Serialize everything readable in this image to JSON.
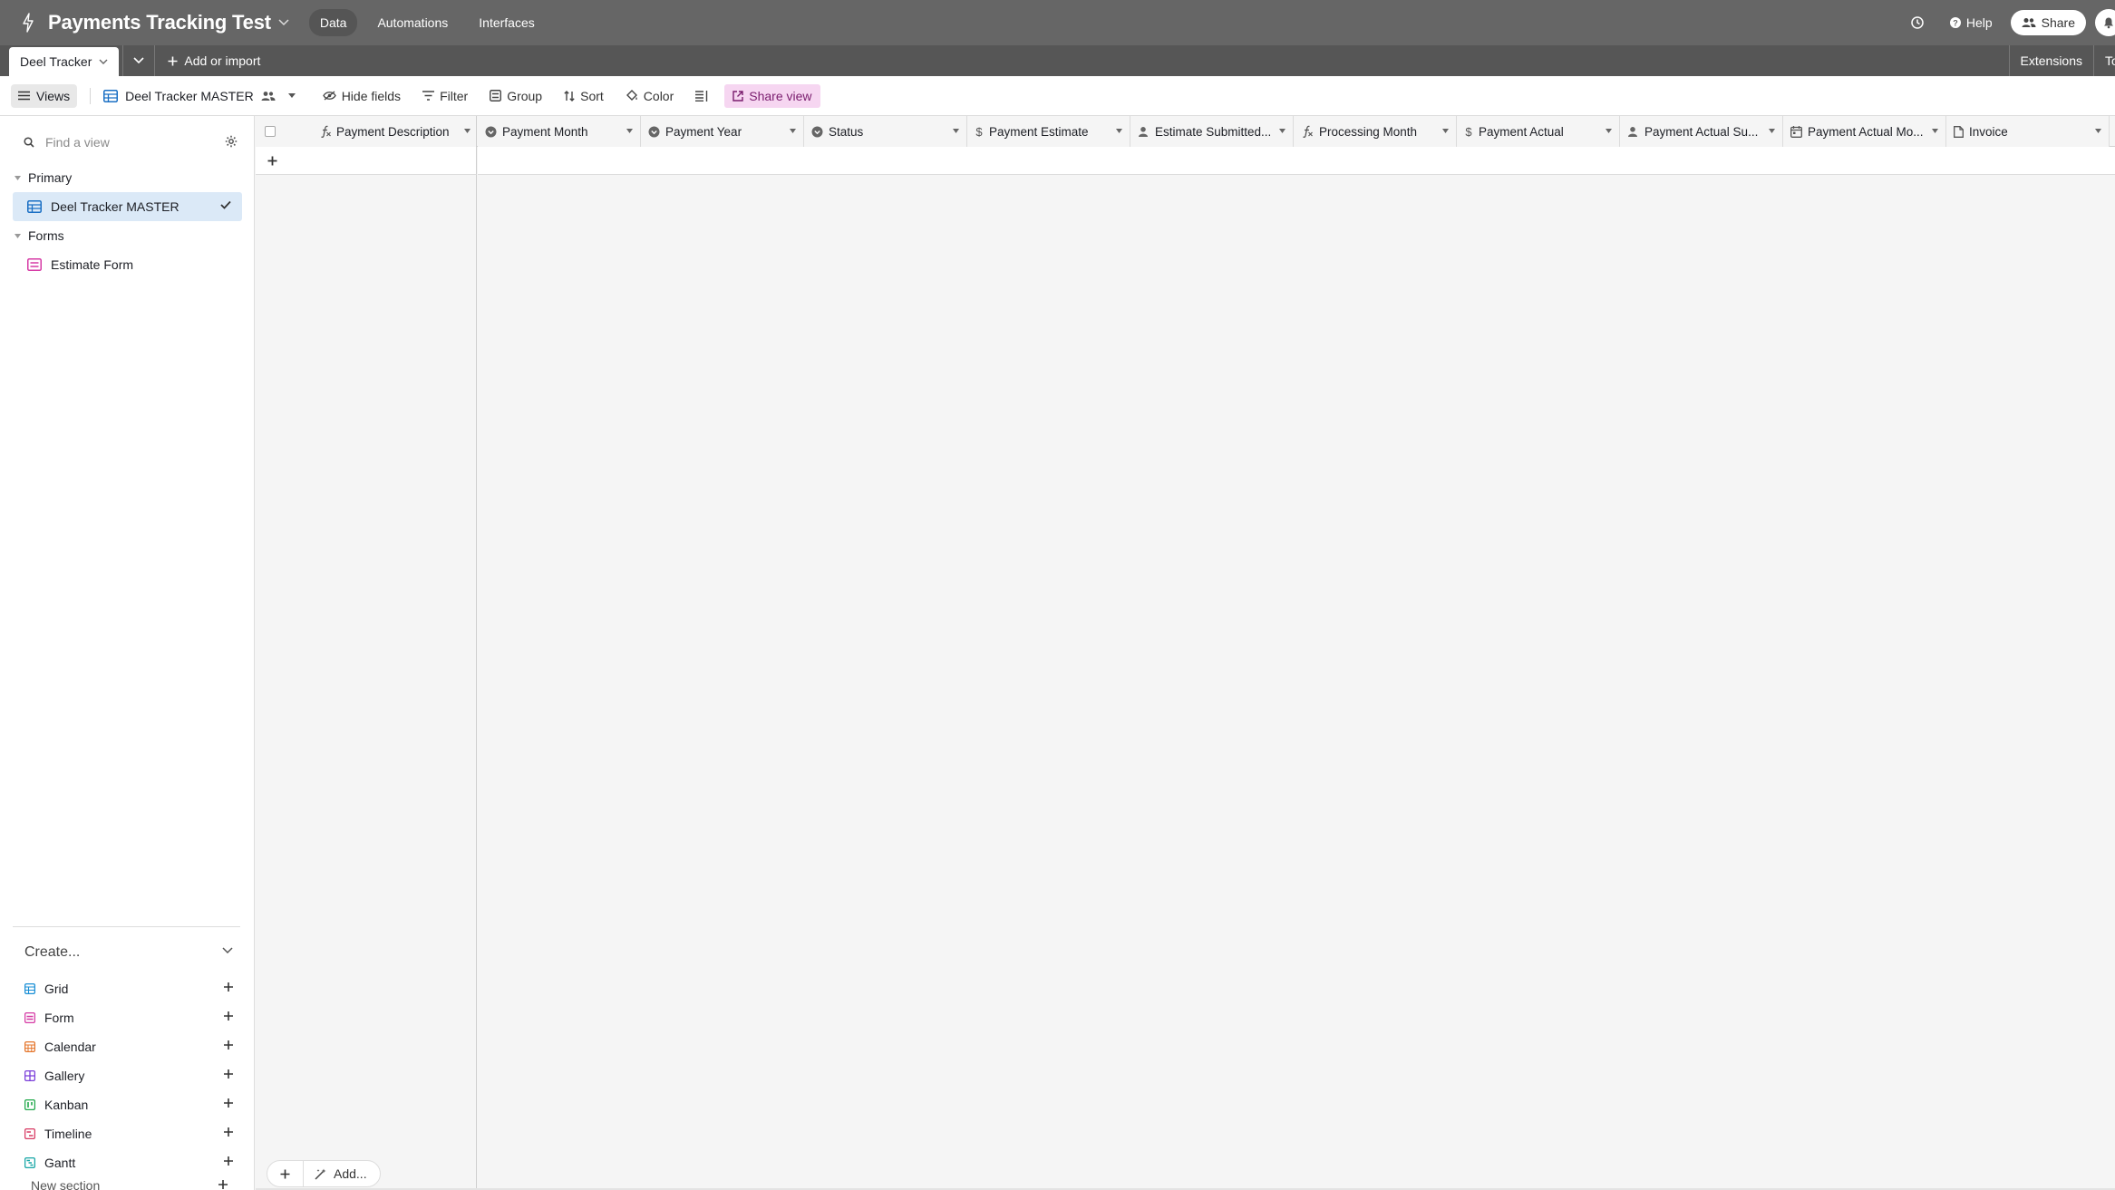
{
  "header": {
    "base_title": "Payments Tracking Test",
    "nav": [
      {
        "label": "Data",
        "active": true
      },
      {
        "label": "Automations",
        "active": false
      },
      {
        "label": "Interfaces",
        "active": false
      }
    ],
    "help_label": "Help",
    "share_label": "Share"
  },
  "tabs": {
    "current_table": "Deel Tracker",
    "add_import_label": "Add or import",
    "extensions_label": "Extensions",
    "tools_label": "To"
  },
  "toolbar": {
    "views_label": "Views",
    "view_name": "Deel Tracker MASTER",
    "hide_fields": "Hide fields",
    "filter": "Filter",
    "group": "Group",
    "sort": "Sort",
    "color": "Color",
    "share_view": "Share view"
  },
  "sidebar": {
    "search_placeholder": "Find a view",
    "sections": [
      {
        "title": "Primary",
        "items": [
          {
            "label": "Deel Tracker MASTER",
            "type": "grid",
            "selected": true
          }
        ]
      },
      {
        "title": "Forms",
        "items": [
          {
            "label": "Estimate Form",
            "type": "form",
            "selected": false
          }
        ]
      }
    ],
    "create_label": "Create...",
    "create_items": [
      {
        "label": "Grid",
        "color": "#1a8fd6"
      },
      {
        "label": "Form",
        "color": "#d63aa5"
      },
      {
        "label": "Calendar",
        "color": "#e5752b"
      },
      {
        "label": "Gallery",
        "color": "#7b3fd9"
      },
      {
        "label": "Kanban",
        "color": "#20a84a"
      },
      {
        "label": "Timeline",
        "color": "#d83a63"
      },
      {
        "label": "Gantt",
        "color": "#16a6a6"
      }
    ],
    "new_section_label": "New section"
  },
  "grid": {
    "primary_field": "Payment Description",
    "columns": [
      {
        "label": "Payment Month",
        "icon": "single-select-icon"
      },
      {
        "label": "Payment Year",
        "icon": "single-select-icon"
      },
      {
        "label": "Status",
        "icon": "single-select-icon"
      },
      {
        "label": "Payment Estimate",
        "icon": "currency-icon"
      },
      {
        "label": "Estimate Submitted...",
        "icon": "user-icon"
      },
      {
        "label": "Processing Month",
        "icon": "formula-icon"
      },
      {
        "label": "Payment Actual",
        "icon": "currency-icon"
      },
      {
        "label": "Payment Actual Su...",
        "icon": "user-icon"
      },
      {
        "label": "Payment Actual Mo...",
        "icon": "date-icon"
      },
      {
        "label": "Invoice",
        "icon": "attachment-icon"
      }
    ],
    "add_label": "Add..."
  },
  "colors": {
    "header_bg": "#666666",
    "tabbar_bg": "#565656",
    "selected_view_bg": "#dbe9f7",
    "share_view_bg": "#f6d6f1"
  }
}
